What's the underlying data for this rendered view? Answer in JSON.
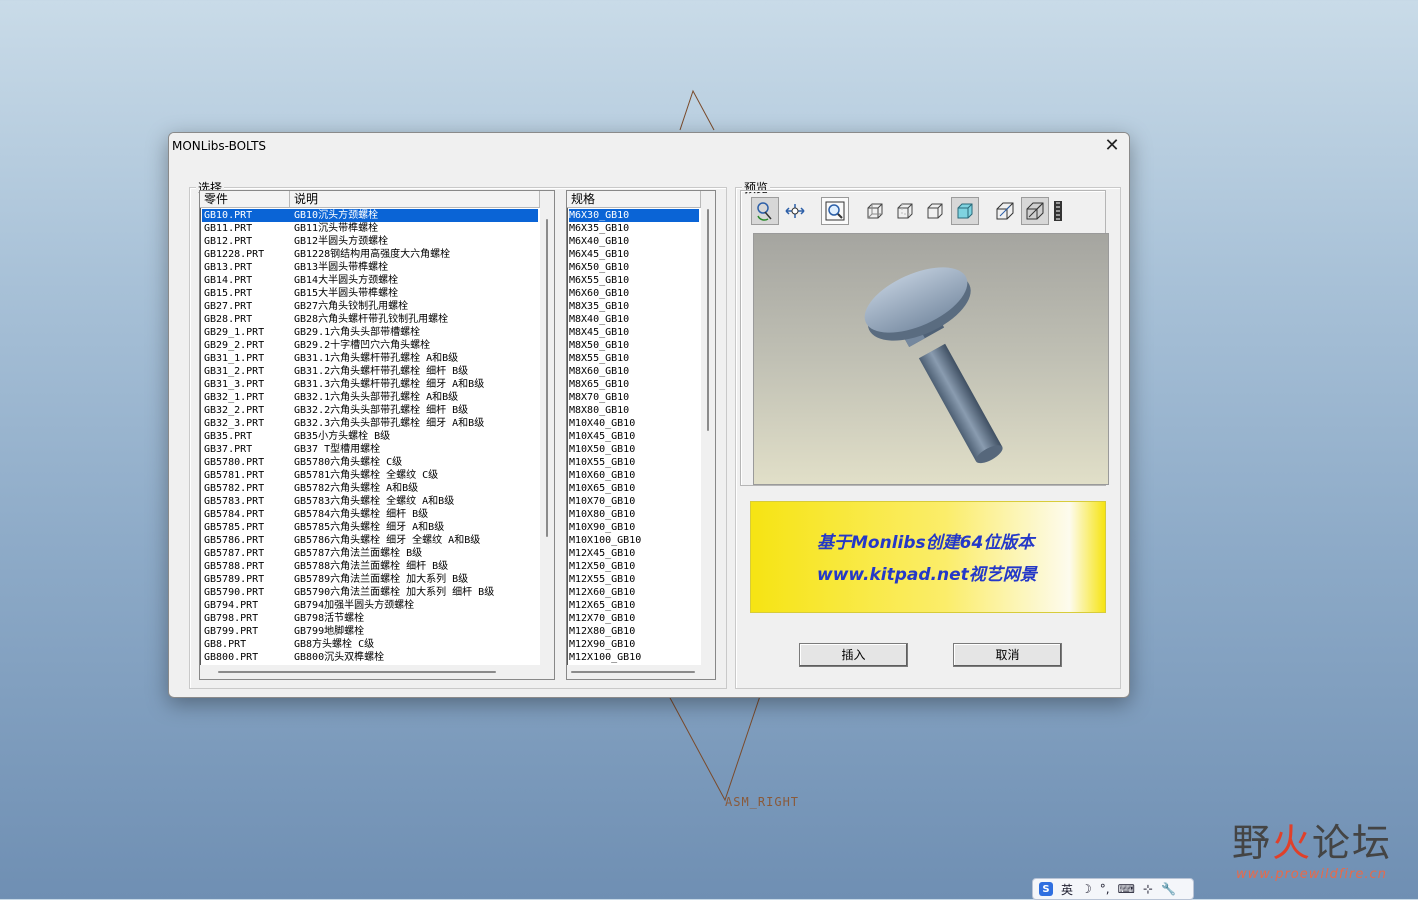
{
  "window": {
    "title": "MONLibs-BOLTS",
    "close_label": "✕"
  },
  "select_group": {
    "label": "选择",
    "parts_list": {
      "headers": [
        "零件",
        "说明"
      ],
      "rows": [
        [
          "GB10.PRT",
          "GB10沉头方颈螺栓"
        ],
        [
          "GB11.PRT",
          "GB11沉头带榫螺栓"
        ],
        [
          "GB12.PRT",
          "GB12半圆头方颈螺栓"
        ],
        [
          "GB1228.PRT",
          "GB1228钢结构用高强度大六角螺栓"
        ],
        [
          "GB13.PRT",
          "GB13半圆头带榫螺栓"
        ],
        [
          "GB14.PRT",
          "GB14大半圆头方颈螺栓"
        ],
        [
          "GB15.PRT",
          "GB15大半圆头带榫螺栓"
        ],
        [
          "GB27.PRT",
          "GB27六角头铰制孔用螺栓"
        ],
        [
          "GB28.PRT",
          "GB28六角头螺杆带孔铰制孔用螺栓"
        ],
        [
          "GB29_1.PRT",
          "GB29.1六角头头部带槽螺栓"
        ],
        [
          "GB29_2.PRT",
          "GB29.2十字槽凹穴六角头螺栓"
        ],
        [
          "GB31_1.PRT",
          "GB31.1六角头螺杆带孔螺栓  A和B级"
        ],
        [
          "GB31_2.PRT",
          "GB31.2六角头螺杆带孔螺栓  细杆  B级"
        ],
        [
          "GB31_3.PRT",
          "GB31.3六角头螺杆带孔螺栓  细牙  A和B级"
        ],
        [
          "GB32_1.PRT",
          "GB32.1六角头头部带孔螺栓  A和B级"
        ],
        [
          "GB32_2.PRT",
          "GB32.2六角头头部带孔螺栓  细杆  B级"
        ],
        [
          "GB32_3.PRT",
          "GB32.3六角头头部带孔螺栓  细牙  A和B级"
        ],
        [
          "GB35.PRT",
          "GB35小方头螺栓  B级"
        ],
        [
          "GB37.PRT",
          "GB37 T型槽用螺栓"
        ],
        [
          "GB5780.PRT",
          "GB5780六角头螺栓  C级"
        ],
        [
          "GB5781.PRT",
          "GB5781六角头螺栓  全螺纹  C级"
        ],
        [
          "GB5782.PRT",
          "GB5782六角头螺栓  A和B级"
        ],
        [
          "GB5783.PRT",
          "GB5783六角头螺栓  全螺纹  A和B级"
        ],
        [
          "GB5784.PRT",
          "GB5784六角头螺栓  细杆  B级"
        ],
        [
          "GB5785.PRT",
          "GB5785六角头螺栓  细牙  A和B级"
        ],
        [
          "GB5786.PRT",
          "GB5786六角头螺栓  细牙  全螺纹  A和B级"
        ],
        [
          "GB5787.PRT",
          "GB5787六角法兰面螺栓  B级"
        ],
        [
          "GB5788.PRT",
          "GB5788六角法兰面螺栓  细杆  B级"
        ],
        [
          "GB5789.PRT",
          "GB5789六角法兰面螺栓  加大系列  B级"
        ],
        [
          "GB5790.PRT",
          "GB5790六角法兰面螺栓  加大系列  细杆  B级"
        ],
        [
          "GB794.PRT",
          "GB794加强半圆头方颈螺栓"
        ],
        [
          "GB798.PRT",
          "GB798活节螺栓"
        ],
        [
          "GB799.PRT",
          "GB799地脚螺栓"
        ],
        [
          "GB8.PRT",
          "GB8方头螺栓  C级"
        ],
        [
          "GB800.PRT",
          "GB800沉头双榫螺栓"
        ]
      ],
      "selected_index": 0
    },
    "spec_list": {
      "header": "规格",
      "rows": [
        "M6X30_GB10",
        "M6X35_GB10",
        "M6X40_GB10",
        "M6X45_GB10",
        "M6X50_GB10",
        "M6X55_GB10",
        "M6X60_GB10",
        "M8X35_GB10",
        "M8X40_GB10",
        "M8X45_GB10",
        "M8X50_GB10",
        "M8X55_GB10",
        "M8X60_GB10",
        "M8X65_GB10",
        "M8X70_GB10",
        "M8X80_GB10",
        "M10X40_GB10",
        "M10X45_GB10",
        "M10X50_GB10",
        "M10X55_GB10",
        "M10X60_GB10",
        "M10X65_GB10",
        "M10X70_GB10",
        "M10X80_GB10",
        "M10X90_GB10",
        "M10X100_GB10",
        "M12X45_GB10",
        "M12X50_GB10",
        "M12X55_GB10",
        "M12X60_GB10",
        "M12X65_GB10",
        "M12X70_GB10",
        "M12X80_GB10",
        "M12X90_GB10",
        "M12X100_GB10"
      ],
      "selected_index": 0
    }
  },
  "preview_group": {
    "label": "预览",
    "toolbar_icons": [
      "spin-icon",
      "pan-icon",
      "zoom-window-icon",
      "wireframe-icon",
      "hidden-line-icon",
      "no-hidden-icon",
      "shading-icon",
      "perspective-icon",
      "orient-icon",
      "film-icon"
    ],
    "banner": {
      "line1": "基于Monlibs创建64位版本",
      "line2": "www.kitpad.net视艺网景",
      "text_color": "#2438c8"
    },
    "insert_label": "插入",
    "cancel_label": "取消"
  },
  "background": {
    "datum_label": "ASM_RIGHT",
    "watermark_main_a": "野",
    "watermark_main_b": "火",
    "watermark_main_c": "论坛",
    "watermark_url": "www.proewildfire.cn"
  },
  "taskbar_ime": {
    "lang": "英",
    "items": [
      "☽",
      "°,",
      "⌨",
      "⊹",
      "🔧"
    ]
  }
}
